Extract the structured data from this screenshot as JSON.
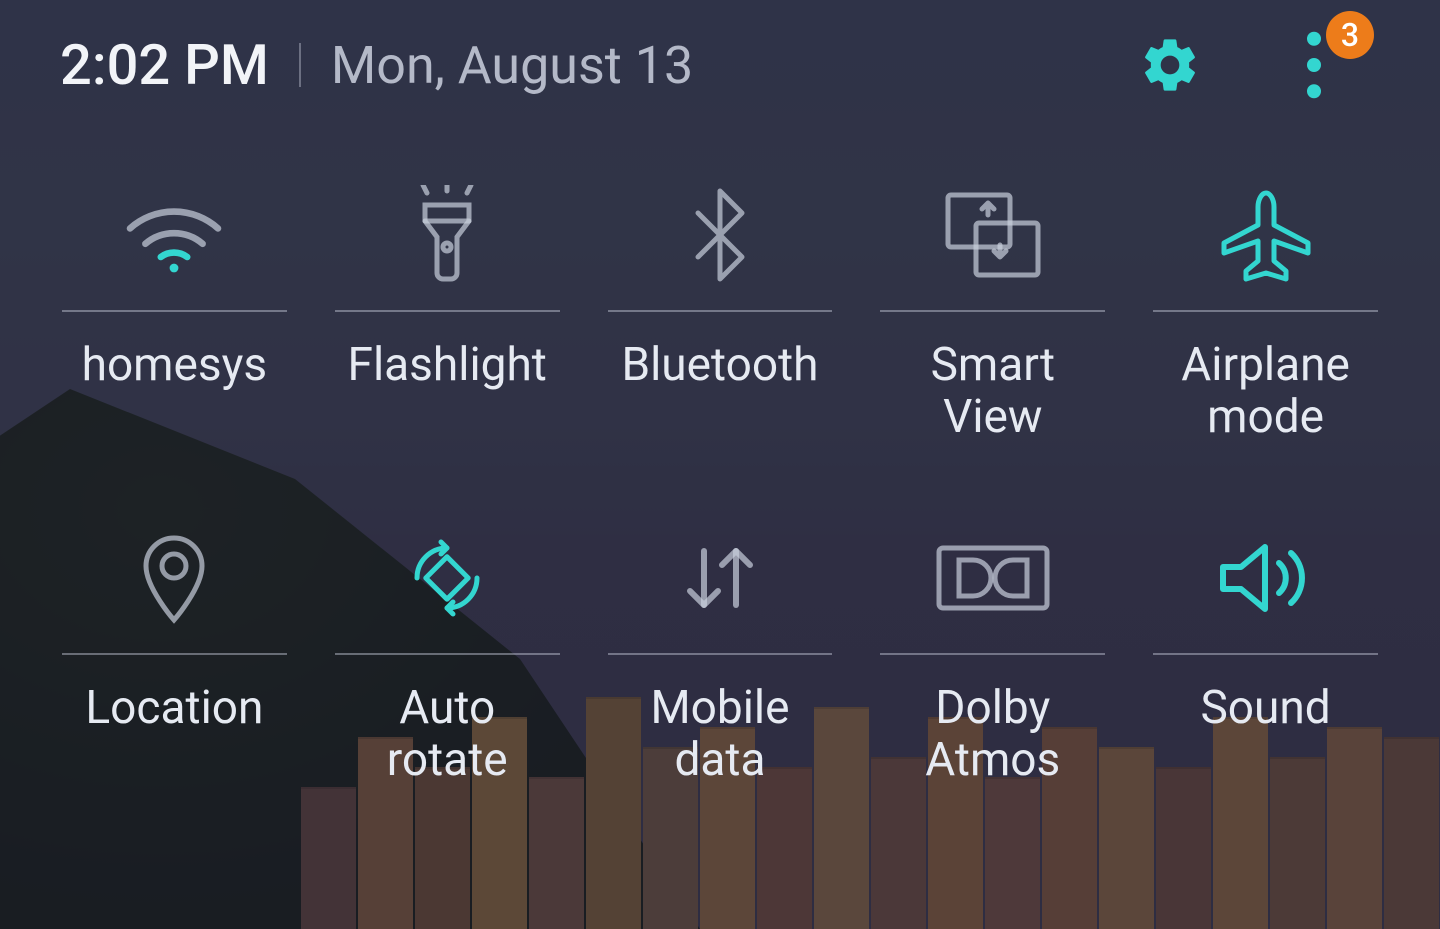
{
  "colors": {
    "accent": "#33d6d0",
    "badge": "#ed7c1a",
    "text": "#e8ecf4",
    "iconInactive": "rgba(200,206,220,0.70)"
  },
  "header": {
    "time": "2:02 PM",
    "date": "Mon, August 13",
    "badge_count": "3"
  },
  "tiles": [
    {
      "icon": "wifi-icon",
      "label": "homesys",
      "active": true
    },
    {
      "icon": "flashlight-icon",
      "label": "Flashlight",
      "active": false
    },
    {
      "icon": "bluetooth-icon",
      "label": "Bluetooth",
      "active": false
    },
    {
      "icon": "smart-view-icon",
      "label": "Smart View",
      "active": false
    },
    {
      "icon": "airplane-icon",
      "label": "Airplane mode",
      "active": true
    },
    {
      "icon": "location-icon",
      "label": "Location",
      "active": false
    },
    {
      "icon": "auto-rotate-icon",
      "label": "Auto rotate",
      "active": true
    },
    {
      "icon": "mobile-data-icon",
      "label": "Mobile data",
      "active": false
    },
    {
      "icon": "dolby-atmos-icon",
      "label": "Dolby Atmos",
      "active": false
    },
    {
      "icon": "sound-icon",
      "label": "Sound",
      "active": true
    }
  ]
}
